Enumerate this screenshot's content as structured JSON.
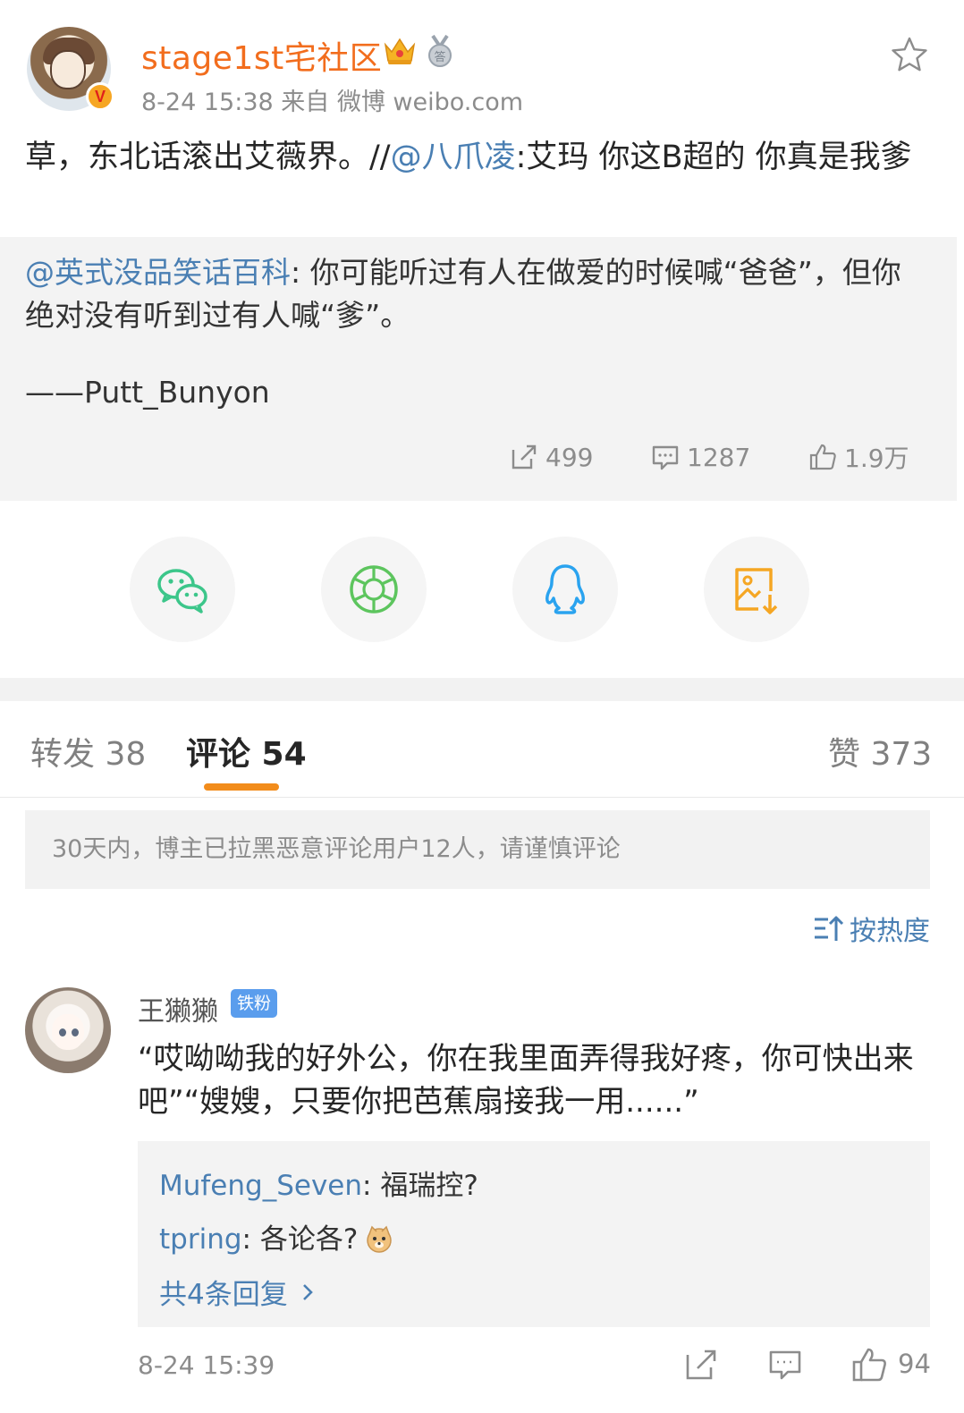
{
  "post": {
    "username": "stage1st宅社区",
    "meta": "8-24 15:38   来自 微博 weibo.com",
    "body_prefix": "草，东北话滚出艾薇界。//",
    "body_mention": "@八爪凌",
    "body_suffix": ":艾玛 你这B超的 你真是我爹",
    "icons": [
      "crown-icon",
      "medal-icon",
      "star-icon",
      "verified-badge"
    ]
  },
  "retweet": {
    "mention": "@英式没品笑话百科",
    "text": ": 你可能听过有人在做爱的时候喊“爸爸”，但你绝对没有听到过有人喊“爹”。",
    "signature": "——Putt_Bunyon",
    "reposts": "499",
    "comments": "1287",
    "likes": "1.9万"
  },
  "share": {
    "buttons": [
      "wechat-icon",
      "moments-icon",
      "qq-icon",
      "save-image-icon"
    ]
  },
  "tabs": {
    "repost": "转发 38",
    "comment": "评论 54",
    "like": "赞 373"
  },
  "notice": "30天内，博主已拉黑恶意评论用户12人，请谨慎评论",
  "sort_label": "按热度",
  "comment": {
    "username": "王獭獭",
    "badge": "铁粉",
    "text": "“哎呦呦我的好外公，你在我里面弄得我好疼，你可快出来吧”“嫂嫂，只要你把芭蕉扇接我一用......”",
    "replies": [
      {
        "user": "Mufeng_Seven",
        "text": ": 福瑞控?"
      },
      {
        "user": "tpring",
        "text": ": 各论各?"
      }
    ],
    "more_replies": "共4条回复",
    "time": "8-24 15:39",
    "likes": "94"
  },
  "colors": {
    "username": "#f26d1d",
    "link": "#4a7fb3",
    "tab_underline": "#f28c1b",
    "fan_badge": "#5a9ded"
  }
}
